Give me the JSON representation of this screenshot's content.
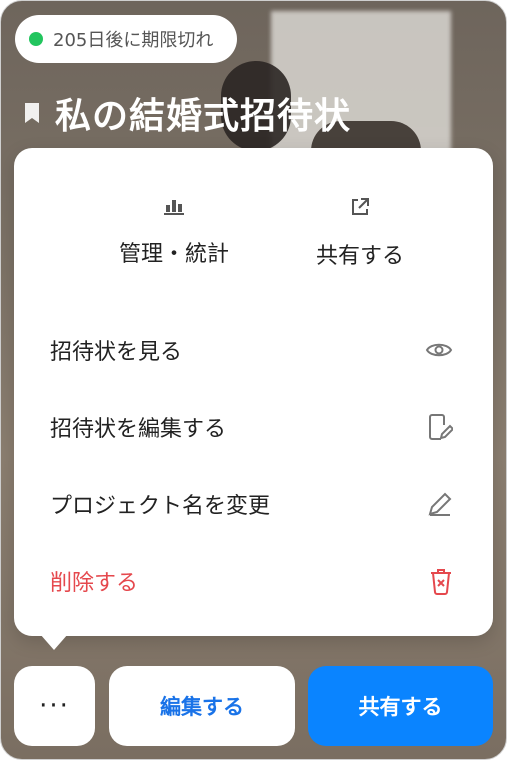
{
  "badge": {
    "text": "205日後に期限切れ",
    "dot_color": "#22c55e"
  },
  "header": {
    "title": "私の結婚式招待状",
    "bookmark_icon": "bookmark-icon"
  },
  "menu": {
    "top_actions": [
      {
        "label": "管理・統計",
        "icon": "bar-chart-icon"
      },
      {
        "label": "共有する",
        "icon": "external-link-icon"
      }
    ],
    "items": [
      {
        "label": "招待状を見る",
        "icon": "eye-icon"
      },
      {
        "label": "招待状を編集する",
        "icon": "edit-document-icon"
      },
      {
        "label": "プロジェクト名を変更",
        "icon": "pencil-icon"
      },
      {
        "label": "削除する",
        "icon": "trash-icon",
        "danger": true
      }
    ]
  },
  "bottom_bar": {
    "more_label": "···",
    "edit_label": "編集する",
    "share_label": "共有する"
  },
  "colors": {
    "accent": "#0a84ff",
    "edit_text": "#1a73e8",
    "danger": "#e5484d"
  }
}
